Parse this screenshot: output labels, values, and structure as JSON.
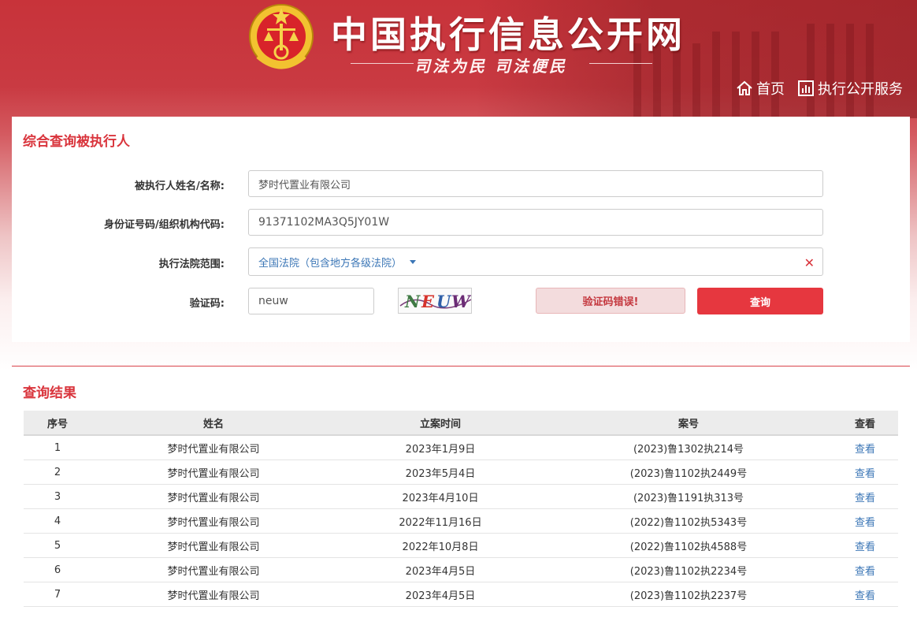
{
  "header": {
    "site_title": "中国执行信息公开网",
    "slogan": "司法为民  司法便民",
    "nav": [
      {
        "label": "首页",
        "icon": "home-icon"
      },
      {
        "label": "执行公开服务",
        "icon": "bar-chart-icon"
      }
    ]
  },
  "search": {
    "title": "综合查询被执行人",
    "name_label": "被执行人姓名/名称:",
    "name_value": "梦时代置业有限公司",
    "id_label": "身份证号码/组织机构代码:",
    "id_value": "91371102MA3Q5JY01W",
    "court_label": "执行法院范围:",
    "court_value": "全国法院（包含地方各级法院）",
    "captcha_label": "验证码:",
    "captcha_value": "neuw",
    "captcha_image_text": "NEUW",
    "error_label": "验证码错误!",
    "query_label": "查询"
  },
  "results": {
    "title": "查询结果",
    "columns": [
      "序号",
      "姓名",
      "立案时间",
      "案号",
      "查看"
    ],
    "rows": [
      {
        "index": "1",
        "name": "梦时代置业有限公司",
        "date": "2023年1月9日",
        "case_no": "(2023)鲁1302执214号",
        "view": "查看"
      },
      {
        "index": "2",
        "name": "梦时代置业有限公司",
        "date": "2023年5月4日",
        "case_no": "(2023)鲁1102执2449号",
        "view": "查看"
      },
      {
        "index": "3",
        "name": "梦时代置业有限公司",
        "date": "2023年4月10日",
        "case_no": "(2023)鲁1191执313号",
        "view": "查看"
      },
      {
        "index": "4",
        "name": "梦时代置业有限公司",
        "date": "2022年11月16日",
        "case_no": "(2022)鲁1102执5343号",
        "view": "查看"
      },
      {
        "index": "5",
        "name": "梦时代置业有限公司",
        "date": "2022年10月8日",
        "case_no": "(2022)鲁1102执4588号",
        "view": "查看"
      },
      {
        "index": "6",
        "name": "梦时代置业有限公司",
        "date": "2023年4月5日",
        "case_no": "(2023)鲁1102执2234号",
        "view": "查看"
      },
      {
        "index": "7",
        "name": "梦时代置业有限公司",
        "date": "2023年4月5日",
        "case_no": "(2023)鲁1102执2237号",
        "view": "查看"
      }
    ]
  },
  "colors": {
    "brand_red": "#c8333a",
    "accent_red": "#e6373f",
    "link_blue": "#3b76b6"
  }
}
